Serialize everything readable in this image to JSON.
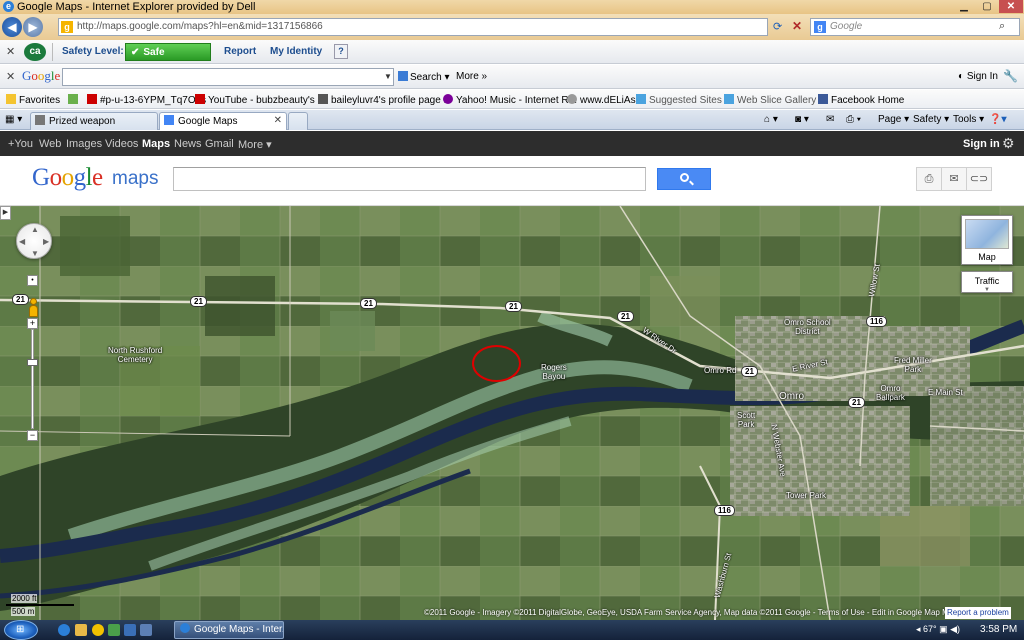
{
  "window": {
    "title": "Google Maps - Internet Explorer provided by Dell"
  },
  "address": {
    "url": "http://maps.google.com/maps?hl=en&mid=1317156866",
    "search_placeholder": "Google"
  },
  "ca_toolbar": {
    "logo": "ca",
    "safety_label": "Safety Level:",
    "safety_value": "Safe",
    "report": "Report",
    "identity": "My Identity",
    "help": "?"
  },
  "google_toolbar": {
    "logo": "Google",
    "search_button": "Search",
    "more": "More »",
    "sign_in": "Sign In"
  },
  "favorites": {
    "label": "Favorites",
    "items": [
      {
        "label": "#p-u-13-6YPM_Tq7O7s"
      },
      {
        "label": "YouTube - bubzbeauty's ..."
      },
      {
        "label": "baileyluvr4's profile page ..."
      },
      {
        "label": "Yahoo! Music - Internet R..."
      },
      {
        "label": "www.dELiAs"
      },
      {
        "label": "Suggested Sites ▾"
      },
      {
        "label": "Web Slice Gallery ▾"
      },
      {
        "label": "Facebook Home"
      }
    ]
  },
  "tabs": [
    {
      "label": "Prized weapon"
    },
    {
      "label": "Google Maps"
    }
  ],
  "commands": {
    "page": "Page ▾",
    "safety": "Safety ▾",
    "tools": "Tools ▾"
  },
  "gbar": {
    "items": [
      "+You",
      "Web",
      "Images",
      "Videos",
      "Maps",
      "News",
      "Gmail",
      "More ▾"
    ],
    "active": "Maps",
    "sign_in": "Sign in"
  },
  "maps_header": {
    "logo": "Google",
    "logo_suffix": "maps"
  },
  "map": {
    "map_type": "Map",
    "traffic": "Traffic",
    "scale_imperial": "2000 ft",
    "scale_metric": "500 m",
    "copyright": "©2011 Google - Imagery ©2011 DigitalGlobe, GeoEye, USDA Farm Service Agency, Map data ©2011 Google - Terms of Use - Edit in Google Map Maker",
    "report": "Report a problem",
    "labels": {
      "north_rushford": "North Rushford\nCemetery",
      "rogers_bayou": "Rogers\nBayou",
      "omro_school": "Omro School\nDistrict",
      "fred_miller": "Fred Miller\nPark",
      "omro_ballpark": "Omro\nBallpark",
      "omro": "Omro",
      "scott_park": "Scott\nPark",
      "tower_park": "Tower Park",
      "omro_rd": "Omro Rd",
      "e_river_st": "E River St",
      "e_main_st": "E Main St",
      "w_river_dr": "W River Dr",
      "winnebago_ave": "N Webster Ave",
      "willow_st": "Willow St",
      "w_main_st": "Washburn St"
    },
    "shields": {
      "r21a": "21",
      "r21b": "21",
      "r21c": "21",
      "r21d": "21",
      "r21e": "21",
      "r21f": "21",
      "r116a": "116",
      "r116b": "116"
    }
  },
  "taskbar": {
    "task": "Google Maps - Inter...",
    "tray": "◂ 67° ▣ ◀)",
    "clock": "3:58 PM"
  },
  "colors": {
    "ca_safe": "#2a9a25",
    "gbar": "#2d2d2d",
    "search_button": "#4a8af4",
    "circle": "#e00000",
    "river": "#1b2b4d"
  }
}
